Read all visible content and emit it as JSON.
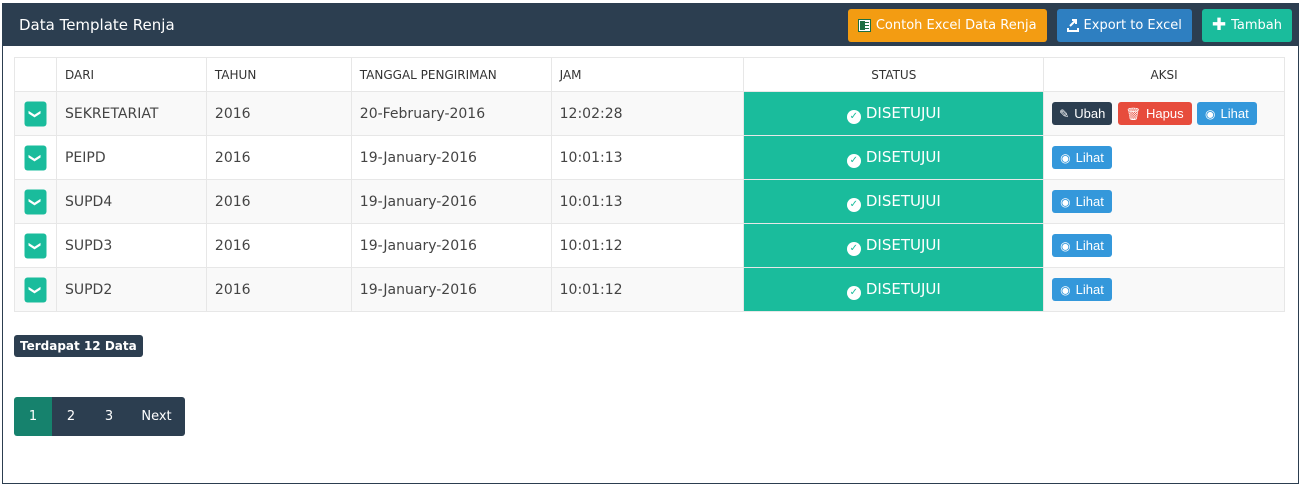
{
  "header": {
    "title": "Data Template Renja",
    "excel_example_label": "Contoh Excel Data Renja",
    "export_label": "Export to Excel",
    "add_label": "Tambah"
  },
  "table": {
    "columns": [
      "DARI",
      "TAHUN",
      "TANGGAL PENGIRIMAN",
      "JAM",
      "STATUS",
      "AKSI"
    ],
    "rows": [
      {
        "dari": "SEKRETARIAT",
        "tahun": "2016",
        "tanggal": "20-February-2016",
        "jam": "12:02:28",
        "status": "DISETUJUI"
      },
      {
        "dari": "PEIPD",
        "tahun": "2016",
        "tanggal": "19-January-2016",
        "jam": "10:01:13",
        "status": "DISETUJUI"
      },
      {
        "dari": "SUPD4",
        "tahun": "2016",
        "tanggal": "19-January-2016",
        "jam": "10:01:13",
        "status": "DISETUJUI"
      },
      {
        "dari": "SUPD3",
        "tahun": "2016",
        "tanggal": "19-January-2016",
        "jam": "10:01:12",
        "status": "DISETUJUI"
      },
      {
        "dari": "SUPD2",
        "tahun": "2016",
        "tanggal": "19-January-2016",
        "jam": "10:01:12",
        "status": "DISETUJUI"
      }
    ],
    "actions": {
      "edit": "Ubah",
      "delete": "Hapus",
      "view": "Lihat"
    }
  },
  "summary": "Terdapat 12 Data",
  "pagination": {
    "pages": [
      "1",
      "2",
      "3"
    ],
    "next": "Next",
    "active": "1"
  },
  "colors": {
    "dark": "#2c3e50",
    "teal": "#1abc9c",
    "orange": "#f39c12",
    "blue": "#2e7fc1",
    "red": "#e74c3c",
    "light_blue": "#3498db"
  },
  "icons": [
    "excel-icon",
    "export-icon",
    "plus-icon",
    "chevron-down-icon",
    "check-circle-icon",
    "edit-icon",
    "trash-icon",
    "eye-icon"
  ]
}
